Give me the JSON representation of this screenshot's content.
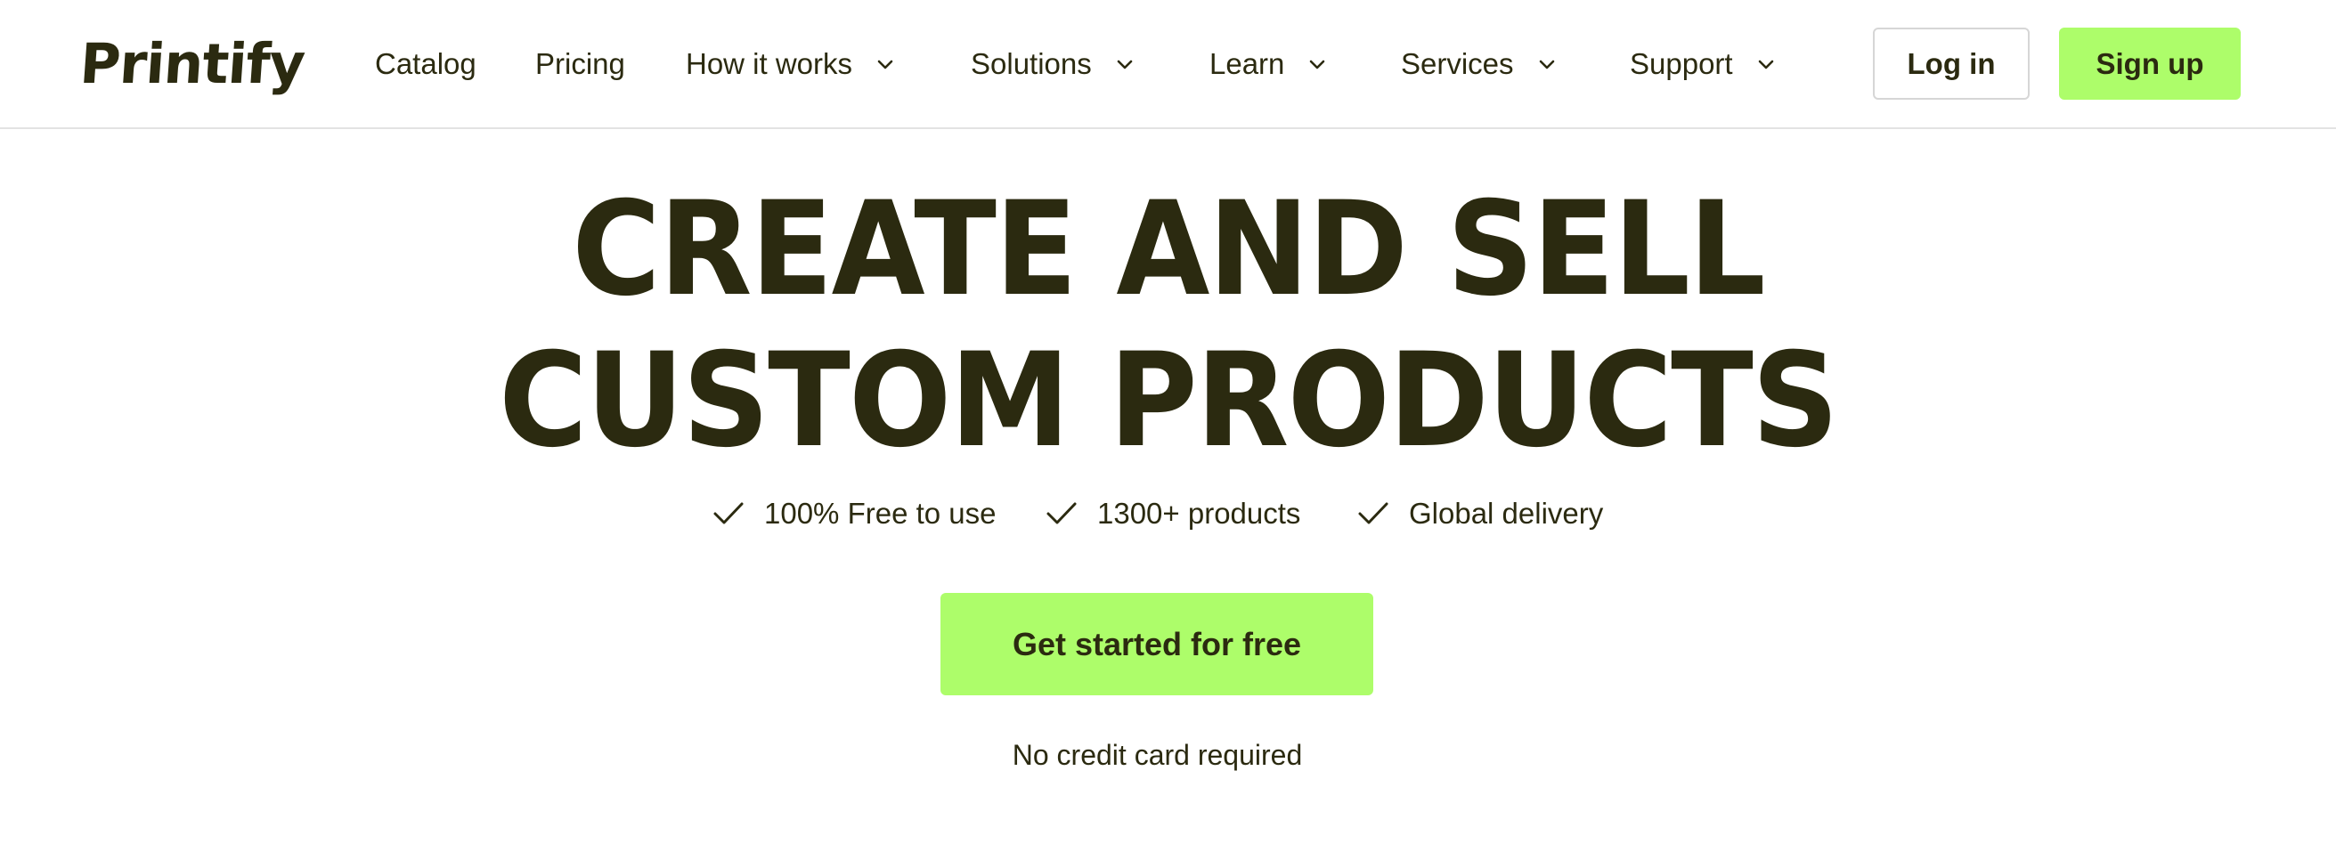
{
  "brand": {
    "name": "Printify"
  },
  "nav": {
    "items": [
      {
        "label": "Catalog",
        "has_dropdown": false
      },
      {
        "label": "Pricing",
        "has_dropdown": false
      },
      {
        "label": "How it works",
        "has_dropdown": true
      },
      {
        "label": "Solutions",
        "has_dropdown": true
      },
      {
        "label": "Learn",
        "has_dropdown": true
      },
      {
        "label": "Services",
        "has_dropdown": true
      },
      {
        "label": "Support",
        "has_dropdown": true
      }
    ],
    "dropdown_icon": "chevron-down-icon"
  },
  "auth": {
    "login_label": "Log in",
    "signup_label": "Sign up"
  },
  "hero": {
    "title_lines": [
      "CREATE AND SELL",
      "CUSTOM PRODUCTS"
    ],
    "features": [
      {
        "icon": "check-icon",
        "label": "100% Free to use"
      },
      {
        "icon": "check-icon",
        "label": "1300+ products"
      },
      {
        "icon": "check-icon",
        "label": "Global delivery"
      }
    ],
    "cta_label": "Get started for free",
    "note": "No credit card required"
  },
  "colors": {
    "text": "#2b2a10",
    "accent": "#adfd6a",
    "border": "#d6d6d6",
    "background": "#ffffff"
  }
}
